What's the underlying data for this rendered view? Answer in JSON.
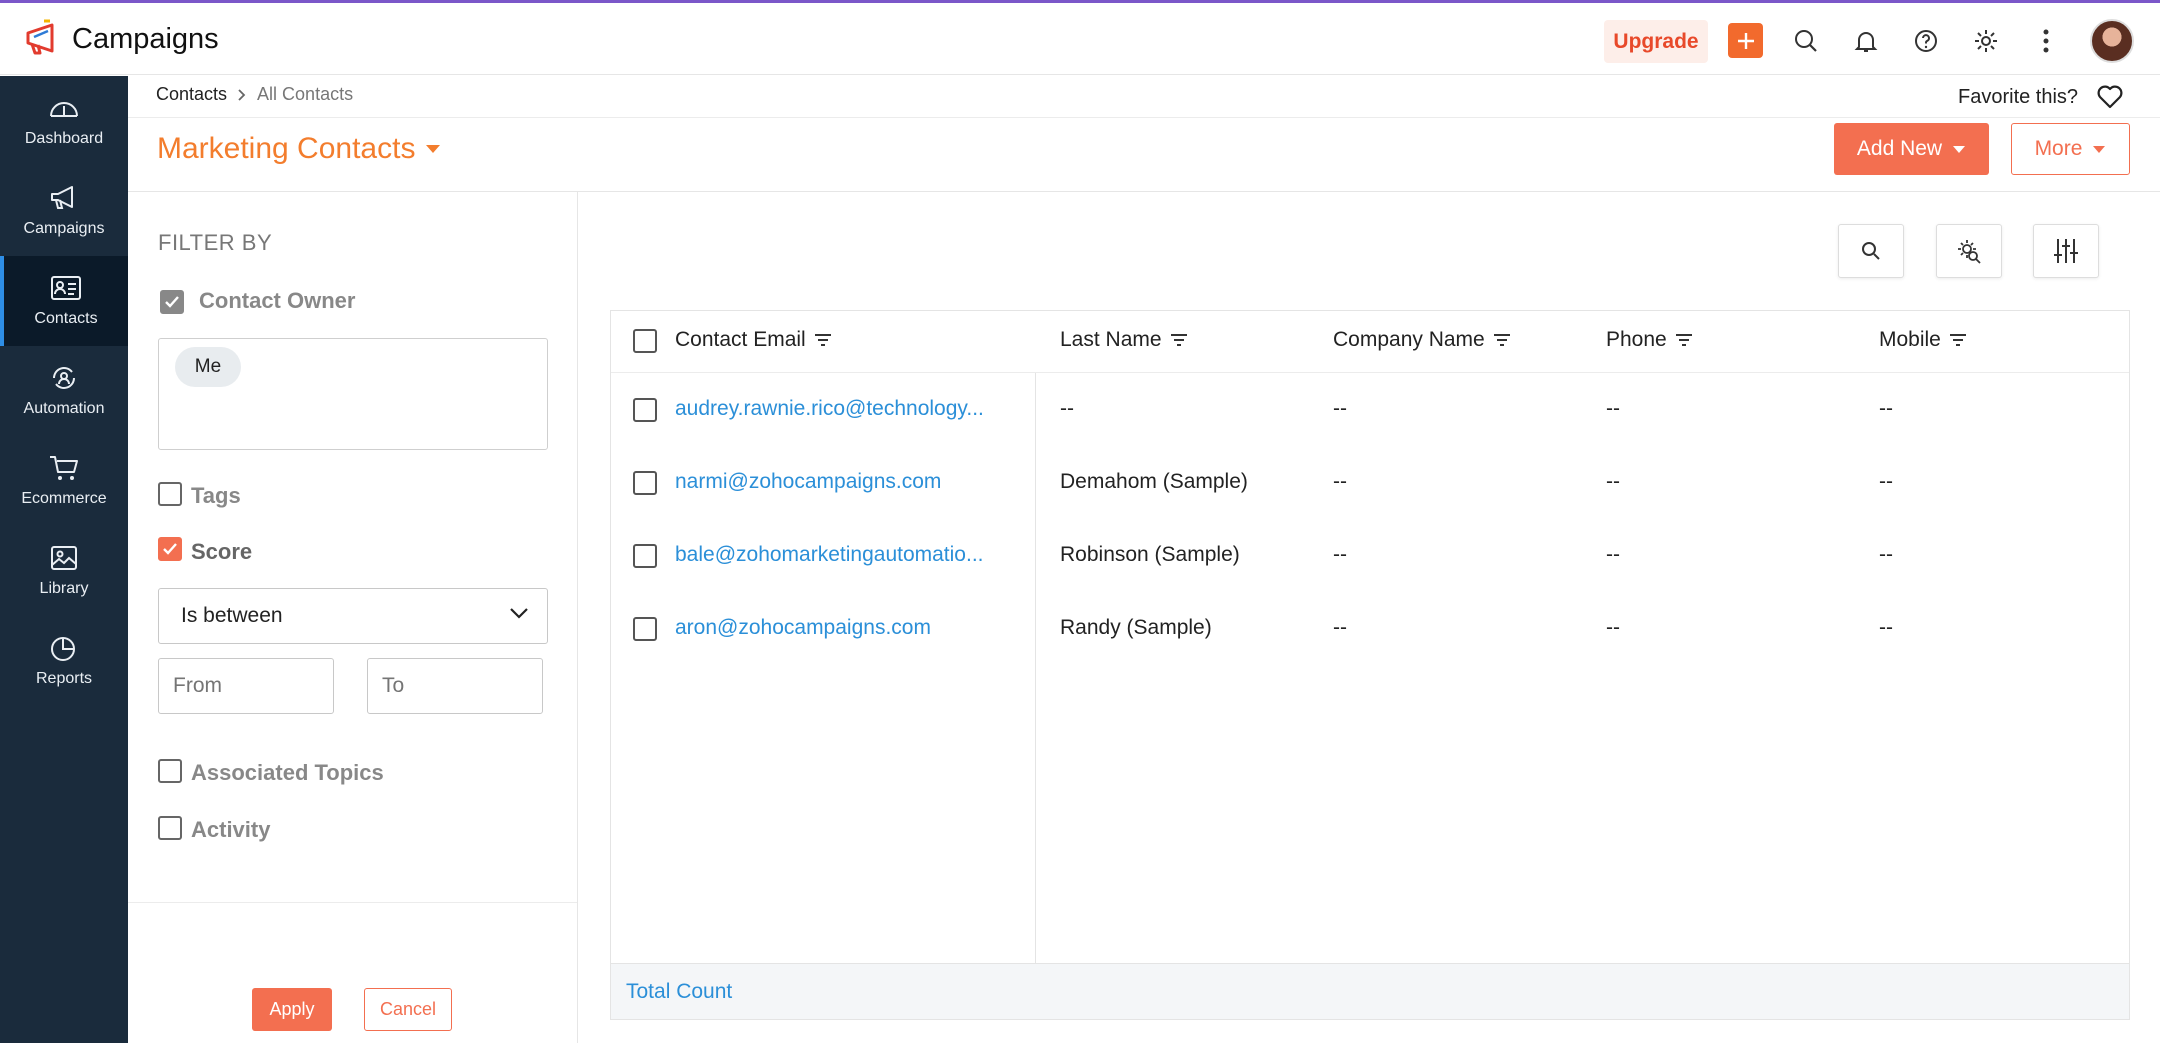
{
  "app": {
    "title": "Campaigns"
  },
  "header": {
    "upgrade_label": "Upgrade",
    "icons": [
      "plus-icon",
      "search-icon",
      "bell-icon",
      "help-icon",
      "gear-icon",
      "more-vertical-icon"
    ]
  },
  "sidebar": {
    "items": [
      {
        "label": "Dashboard",
        "icon": "dashboard-gauge-icon"
      },
      {
        "label": "Campaigns",
        "icon": "megaphone-icon"
      },
      {
        "label": "Contacts",
        "icon": "contact-card-icon",
        "active": true
      },
      {
        "label": "Automation",
        "icon": "automation-icon"
      },
      {
        "label": "Ecommerce",
        "icon": "cart-icon"
      },
      {
        "label": "Library",
        "icon": "image-library-icon"
      },
      {
        "label": "Reports",
        "icon": "pie-chart-icon"
      }
    ]
  },
  "breadcrumb": {
    "parent": "Contacts",
    "current": "All Contacts"
  },
  "favorite": {
    "label": "Favorite this?"
  },
  "page": {
    "title": "Marketing Contacts"
  },
  "actions": {
    "add_new": "Add New",
    "more": "More"
  },
  "filter": {
    "heading": "FILTER BY",
    "contact_owner": {
      "label": "Contact Owner",
      "checked": true,
      "chip": "Me"
    },
    "tags": {
      "label": "Tags",
      "checked": false
    },
    "score": {
      "label": "Score",
      "checked": true,
      "operator": "Is between",
      "from_placeholder": "From",
      "to_placeholder": "To"
    },
    "associated_topics": {
      "label": "Associated Topics",
      "checked": false
    },
    "activity": {
      "label": "Activity",
      "checked": false
    },
    "apply_label": "Apply",
    "cancel_label": "Cancel"
  },
  "table": {
    "columns": [
      "Contact Email",
      "Last Name",
      "Company Name",
      "Phone",
      "Mobile"
    ],
    "rows": [
      {
        "email": "audrey.rawnie.rico@technology...",
        "last_name": "--",
        "company": "--",
        "phone": "--",
        "mobile": "--"
      },
      {
        "email": "narmi@zohocampaigns.com",
        "last_name": "Demahom (Sample)",
        "company": "--",
        "phone": "--",
        "mobile": "--"
      },
      {
        "email": "bale@zohomarketingautomatio...",
        "last_name": "Robinson (Sample)",
        "company": "--",
        "phone": "--",
        "mobile": "--"
      },
      {
        "email": "aron@zohocampaigns.com",
        "last_name": "Randy (Sample)",
        "company": "--",
        "phone": "--",
        "mobile": "--"
      }
    ],
    "footer": "Total Count"
  },
  "colors": {
    "accent": "#f36f50",
    "sidebar": "#1a2b3c",
    "link": "#2b8fd8",
    "title": "#f37d2d"
  }
}
